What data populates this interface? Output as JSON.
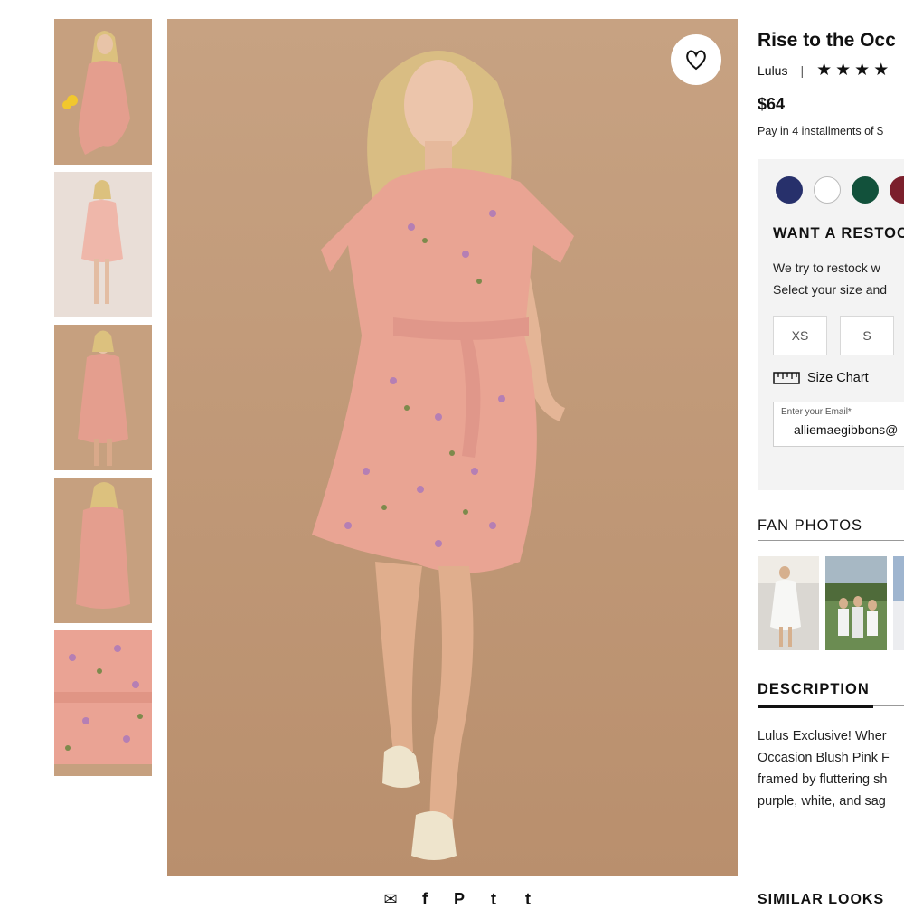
{
  "product": {
    "title": "Rise to the Occ",
    "brand": "Lulus",
    "rating_stars": "★★★★",
    "price": "$64",
    "installments": "Pay in 4 installments of $"
  },
  "colors": {
    "swatches": [
      {
        "name": "navy",
        "hex": "#27306b"
      },
      {
        "name": "white",
        "hex": "#ffffff"
      },
      {
        "name": "green",
        "hex": "#12513b"
      },
      {
        "name": "burgundy",
        "hex": "#7b1f2c"
      }
    ],
    "photo_background": "#c49d7c",
    "dress_pink": "#e9a493"
  },
  "restock": {
    "title": "WANT A RESTOC",
    "line1": "We try to restock w",
    "line2": "Select your size and",
    "sizes": [
      "XS",
      "S"
    ],
    "size_chart_label": "Size Chart",
    "email_label": "Enter your Email*",
    "email_value": "alliemaegibbons@"
  },
  "fan_photos": {
    "title": "FAN PHOTOS"
  },
  "description": {
    "title": "DESCRIPTION",
    "lines": [
      "Lulus Exclusive! Wher",
      "Occasion Blush Pink F",
      "framed by fluttering sh",
      "purple, white, and sag"
    ]
  },
  "share_icons": [
    "email-icon",
    "facebook-icon",
    "pinterest-icon",
    "twitter-icon",
    "tumblr-icon"
  ],
  "share_glyphs": {
    "email": "✉",
    "facebook": "f",
    "pinterest": "P",
    "twitter": "t",
    "tumblr": "t"
  },
  "similar_looks": "SIMILAR LOOKS"
}
